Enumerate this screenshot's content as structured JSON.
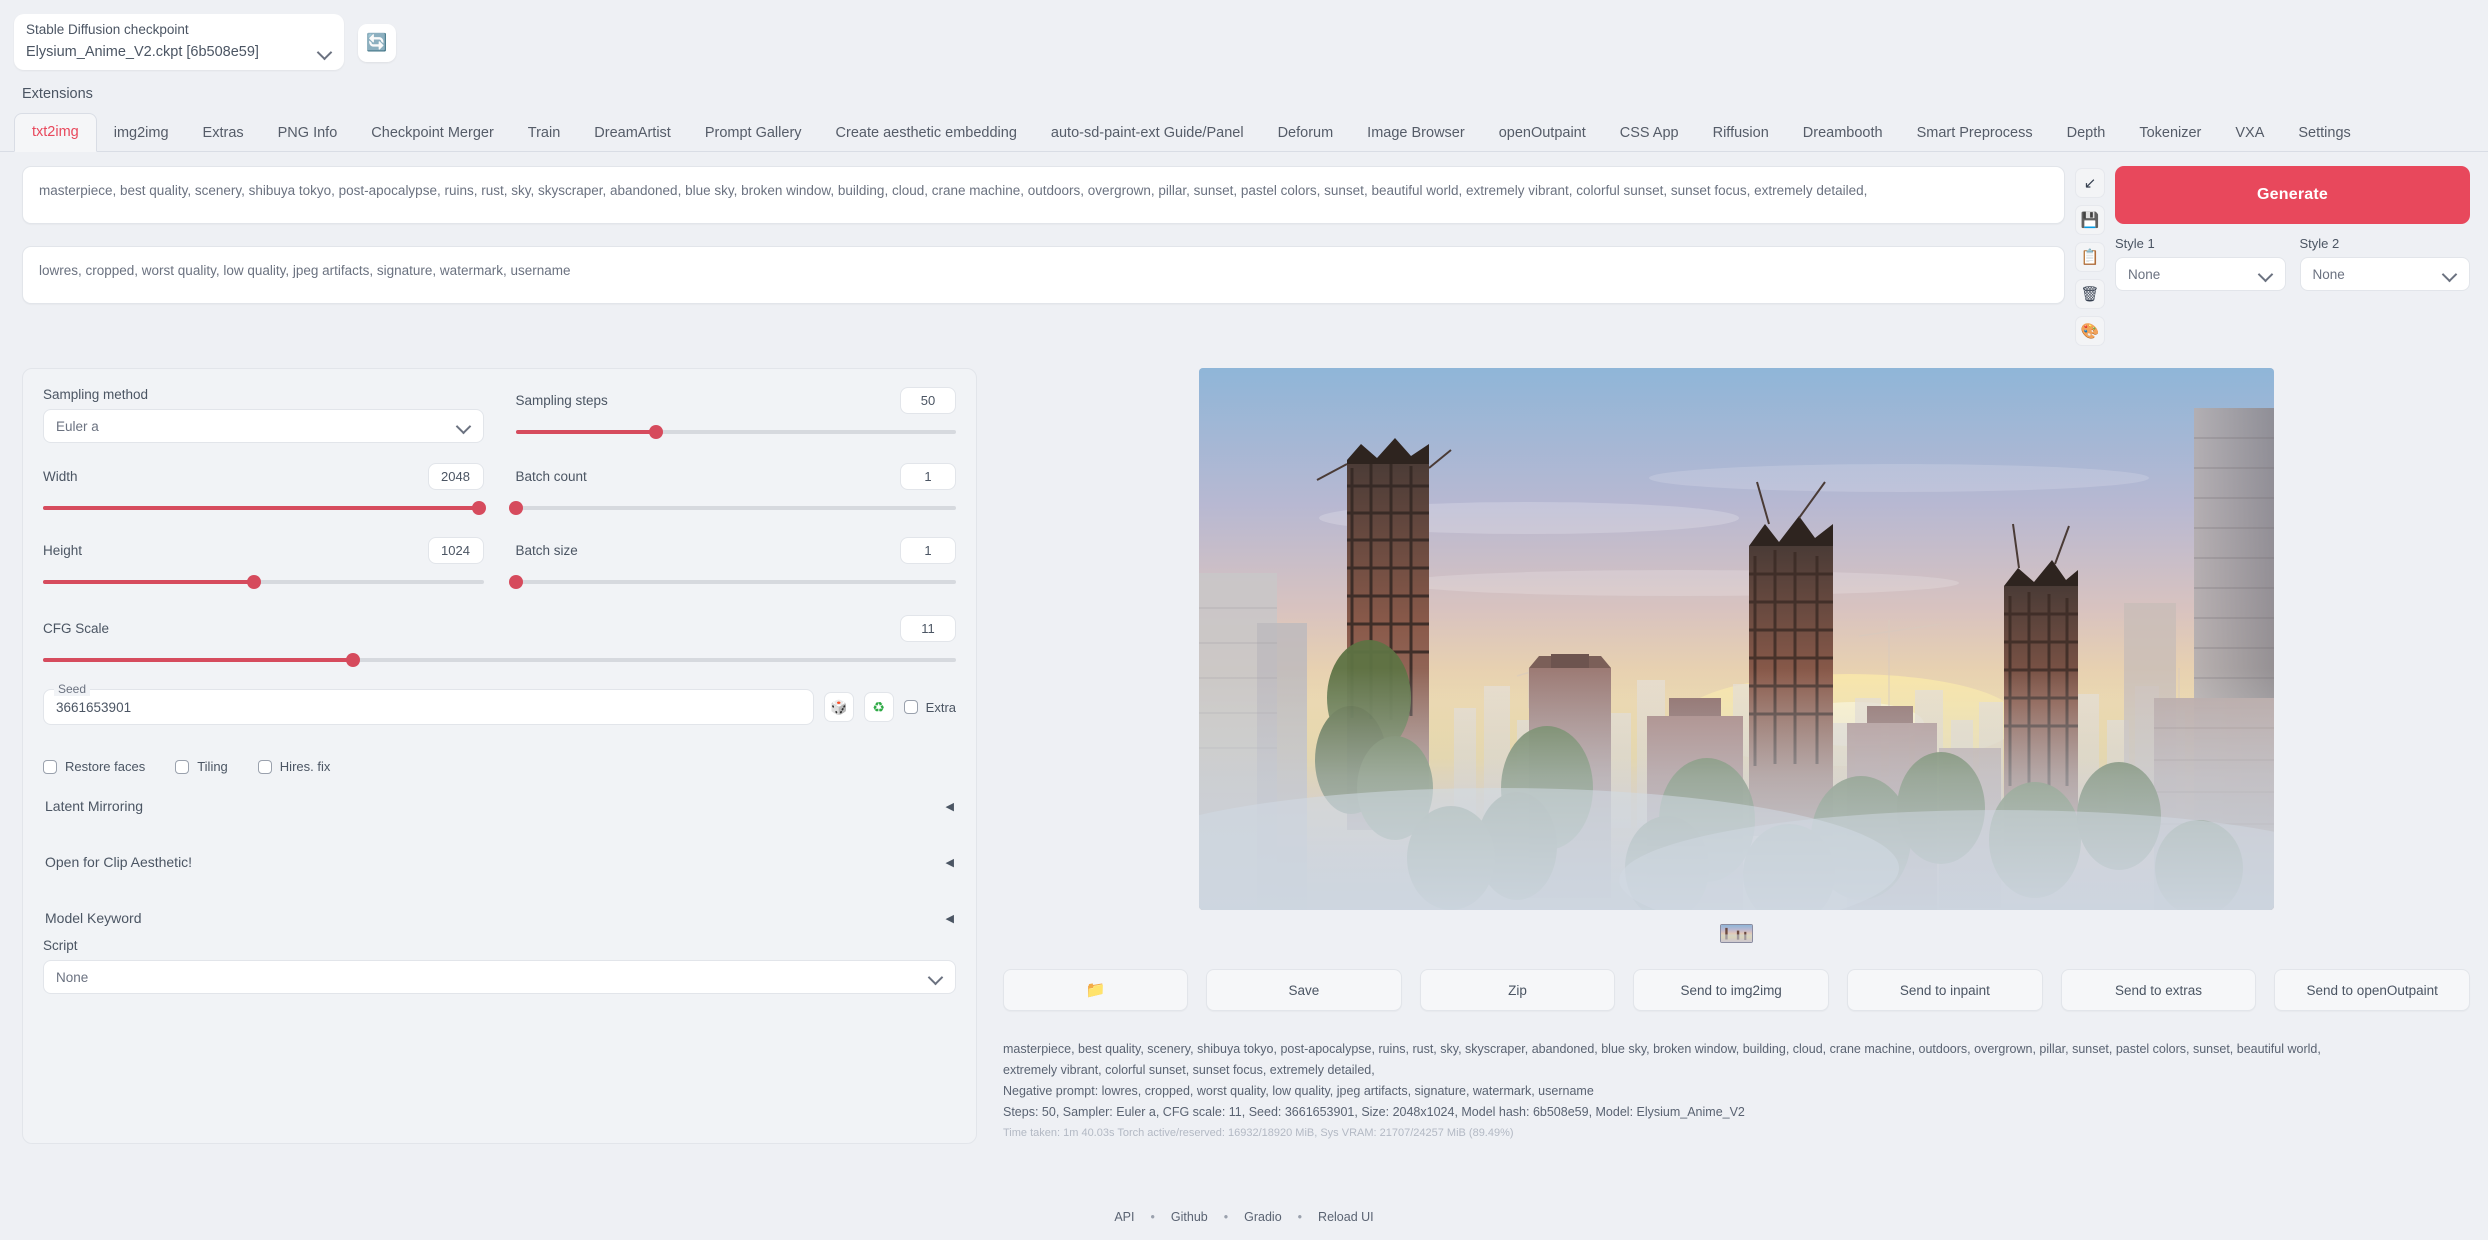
{
  "topbar": {
    "checkpoint_label": "Stable Diffusion checkpoint",
    "checkpoint_value": "Elysium_Anime_V2.ckpt [6b508e59]",
    "refresh_icon": "🔄",
    "extensions_label": "Extensions"
  },
  "tabs": [
    {
      "label": "txt2img",
      "active": true
    },
    {
      "label": "img2img",
      "active": false
    },
    {
      "label": "Extras",
      "active": false
    },
    {
      "label": "PNG Info",
      "active": false
    },
    {
      "label": "Checkpoint Merger",
      "active": false
    },
    {
      "label": "Train",
      "active": false
    },
    {
      "label": "DreamArtist",
      "active": false
    },
    {
      "label": "Prompt Gallery",
      "active": false
    },
    {
      "label": "Create aesthetic embedding",
      "active": false
    },
    {
      "label": "auto-sd-paint-ext Guide/Panel",
      "active": false
    },
    {
      "label": "Deforum",
      "active": false
    },
    {
      "label": "Image Browser",
      "active": false
    },
    {
      "label": "openOutpaint",
      "active": false
    },
    {
      "label": "CSS App",
      "active": false
    },
    {
      "label": "Riffusion",
      "active": false
    },
    {
      "label": "Dreambooth",
      "active": false
    },
    {
      "label": "Smart Preprocess",
      "active": false
    },
    {
      "label": "Depth",
      "active": false
    },
    {
      "label": "Tokenizer",
      "active": false
    },
    {
      "label": "VXA",
      "active": false
    },
    {
      "label": "Settings",
      "active": false
    }
  ],
  "prompt": {
    "positive": "masterpiece, best quality, scenery, shibuya tokyo, post-apocalypse, ruins, rust, sky, skyscraper, abandoned, blue sky, broken window, building, cloud, crane machine, outdoors, overgrown, pillar, sunset, pastel colors, sunset, beautiful world, extremely vibrant, colorful sunset, sunset focus, extremely detailed,",
    "negative": "lowres, cropped, worst quality, low quality, jpeg artifacts, signature, watermark, username"
  },
  "prompt_icons": [
    {
      "name": "arrow-into-box-icon",
      "glyph": "↙"
    },
    {
      "name": "save-floppy-icon",
      "glyph": "💾"
    },
    {
      "name": "clipboard-icon",
      "glyph": "📋"
    },
    {
      "name": "trash-icon",
      "glyph": "🗑"
    },
    {
      "name": "palette-icon",
      "glyph": "🎨"
    }
  ],
  "generate": {
    "label": "Generate",
    "color": "#e8485c"
  },
  "styles": {
    "style1_label": "Style 1",
    "style1_value": "None",
    "style2_label": "Style 2",
    "style2_value": "None"
  },
  "settings": {
    "sampling_method_label": "Sampling method",
    "sampling_method_value": "Euler a",
    "sampling_steps_label": "Sampling steps",
    "sampling_steps_value": "50",
    "sampling_steps_pct": 32,
    "width_label": "Width",
    "width_value": "2048",
    "width_pct": 99,
    "height_label": "Height",
    "height_value": "1024",
    "height_pct": 48,
    "batch_count_label": "Batch count",
    "batch_count_value": "1",
    "batch_count_pct": 0,
    "batch_size_label": "Batch size",
    "batch_size_value": "1",
    "batch_size_pct": 0,
    "cfg_scale_label": "CFG Scale",
    "cfg_scale_value": "11",
    "cfg_scale_pct": 34,
    "seed_label": "Seed",
    "seed_value": "3661653901",
    "dice_icon": "🎲",
    "recycle_icon": "♻",
    "extra_label": "Extra"
  },
  "checkboxes": [
    {
      "label": "Restore faces",
      "checked": false
    },
    {
      "label": "Tiling",
      "checked": false
    },
    {
      "label": "Hires. fix",
      "checked": false
    }
  ],
  "accordions": [
    {
      "label": "Latent Mirroring",
      "caret": "◀"
    },
    {
      "label": "Open for Clip Aesthetic!",
      "caret": "◀"
    },
    {
      "label": "Model Keyword",
      "caret": "◀"
    }
  ],
  "script": {
    "label": "Script",
    "value": "None"
  },
  "output_buttons": [
    {
      "label": "📁",
      "name": "open-folder-button",
      "folder": true
    },
    {
      "label": "Save",
      "name": "save-button",
      "folder": false
    },
    {
      "label": "Zip",
      "name": "zip-button",
      "folder": false
    },
    {
      "label": "Send to img2img",
      "name": "send-to-img2img-button",
      "folder": false
    },
    {
      "label": "Send to inpaint",
      "name": "send-to-inpaint-button",
      "folder": false
    },
    {
      "label": "Send to extras",
      "name": "send-to-extras-button",
      "folder": false
    },
    {
      "label": "Send to openOutpaint",
      "name": "send-to-openoutpaint-button",
      "folder": false
    }
  ],
  "generation_info": {
    "line1": "masterpiece, best quality, scenery, shibuya tokyo, post-apocalypse, ruins, rust, sky, skyscraper, abandoned, blue sky, broken window, building, cloud, crane machine, outdoors, overgrown, pillar, sunset, pastel colors, sunset, beautiful world,",
    "line2": "extremely vibrant, colorful sunset, sunset focus, extremely detailed,",
    "line3": "Negative prompt: lowres, cropped, worst quality, low quality, jpeg artifacts, signature, watermark, username",
    "line4": "Steps: 50, Sampler: Euler a, CFG scale: 11, Seed: 3661653901, Size: 2048x1024, Model hash: 6b508e59, Model: Elysium_Anime_V2",
    "line5": "Time taken: 1m 40.03s  Torch active/reserved: 16932/18920 MiB, Sys VRAM: 21707/24257 MiB (89.49%)"
  },
  "footer": {
    "items": [
      "API",
      "Github",
      "Gradio",
      "Reload UI"
    ],
    "separator": "•"
  },
  "image": {
    "alt": "post-apocalyptic overgrown city ruins at sunset"
  }
}
